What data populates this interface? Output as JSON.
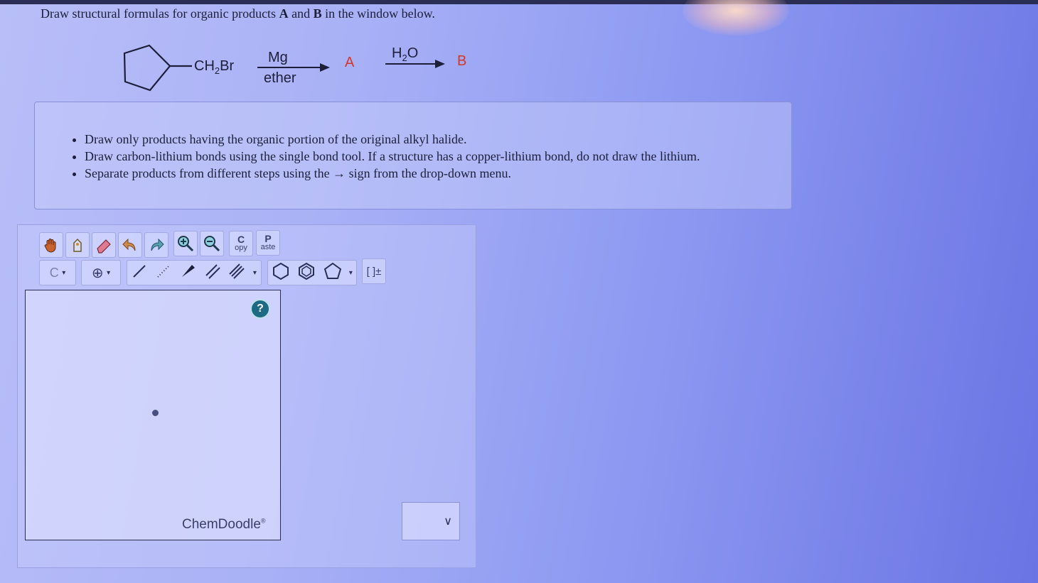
{
  "question": {
    "part1": "Draw structural formulas for organic products ",
    "label_a": "A",
    "part2": " and ",
    "label_b": "B",
    "part3": " in the window below."
  },
  "reaction": {
    "substituent_main": "CH",
    "substituent_sub": "2",
    "substituent_end": "Br",
    "reagent1_top": "Mg",
    "reagent1_bottom": "ether",
    "product_a": "A",
    "reagent2_main": "H",
    "reagent2_sub": "2",
    "reagent2_end": "O",
    "product_b": "B"
  },
  "instructions": [
    "Draw only products having the organic portion of the original alkyl halide.",
    "Draw carbon-lithium bonds using the single bond tool. If a structure has a copper-lithium bond, do not draw the lithium.",
    "Separate products from different steps using the → sign from the drop-down menu."
  ],
  "toolbar": {
    "copy_top": "C",
    "copy_bottom": "opy",
    "paste_top": "P",
    "paste_bottom": "aste",
    "atom_label": "C",
    "charge_symbol": "⊕",
    "bracket_label": "[ ]±",
    "dropdown_glyph": "▾"
  },
  "canvas": {
    "help_label": "?",
    "brand": "ChemDoodle",
    "brand_mark": "®"
  },
  "step_select": {
    "value": "",
    "chevron": "∨"
  }
}
